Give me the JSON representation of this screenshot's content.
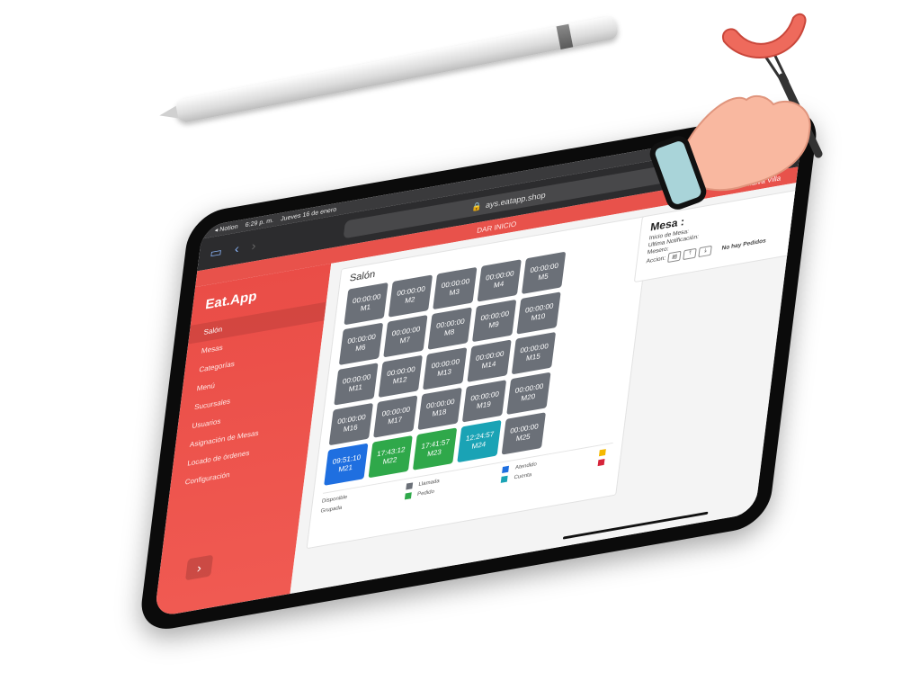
{
  "status_bar": {
    "carrier": "◂ Notion",
    "time": "6:29 p. m.",
    "date": "Jueves 16 de enero"
  },
  "browser": {
    "url": "ays.eatapp.shop",
    "dots": "•••"
  },
  "header": {
    "center": "DAR INICIO",
    "user": "Malva Villa"
  },
  "sidebar": {
    "logo": "Eat.App",
    "items": [
      {
        "label": "Salón",
        "active": true
      },
      {
        "label": "Mesas"
      },
      {
        "label": "Categorías"
      },
      {
        "label": "Menú"
      },
      {
        "label": "Sucursales"
      },
      {
        "label": "Usuarios"
      },
      {
        "label": "Asignación de Mesas"
      },
      {
        "label": "Locado de órdenes"
      },
      {
        "label": "Configuración"
      }
    ],
    "expand_icon": "chevron-right"
  },
  "salon": {
    "title": "Salón",
    "tables": [
      {
        "time": "00:00:00",
        "name": "M1",
        "status": "disponible"
      },
      {
        "time": "00:00:00",
        "name": "M2",
        "status": "disponible"
      },
      {
        "time": "00:00:00",
        "name": "M3",
        "status": "disponible"
      },
      {
        "time": "00:00:00",
        "name": "M4",
        "status": "disponible"
      },
      {
        "time": "00:00:00",
        "name": "M5",
        "status": "disponible"
      },
      {
        "time": "00:00:00",
        "name": "M6",
        "status": "disponible"
      },
      {
        "time": "00:00:00",
        "name": "M7",
        "status": "disponible"
      },
      {
        "time": "00:00:00",
        "name": "M8",
        "status": "disponible"
      },
      {
        "time": "00:00:00",
        "name": "M9",
        "status": "disponible"
      },
      {
        "time": "00:00:00",
        "name": "M10",
        "status": "disponible"
      },
      {
        "time": "00:00:00",
        "name": "M11",
        "status": "disponible"
      },
      {
        "time": "00:00:00",
        "name": "M12",
        "status": "disponible"
      },
      {
        "time": "00:00:00",
        "name": "M13",
        "status": "disponible"
      },
      {
        "time": "00:00:00",
        "name": "M14",
        "status": "disponible"
      },
      {
        "time": "00:00:00",
        "name": "M15",
        "status": "disponible"
      },
      {
        "time": "00:00:00",
        "name": "M16",
        "status": "disponible"
      },
      {
        "time": "00:00:00",
        "name": "M17",
        "status": "disponible"
      },
      {
        "time": "00:00:00",
        "name": "M18",
        "status": "disponible"
      },
      {
        "time": "00:00:00",
        "name": "M19",
        "status": "disponible"
      },
      {
        "time": "00:00:00",
        "name": "M20",
        "status": "disponible"
      },
      {
        "time": "09:51:10",
        "name": "M21",
        "status": "llamada"
      },
      {
        "time": "17:43:12",
        "name": "M22",
        "status": "pedido"
      },
      {
        "time": "17:41:57",
        "name": "M23",
        "status": "pedido"
      },
      {
        "time": "12:24:57",
        "name": "M24",
        "status": "cuenta"
      },
      {
        "time": "00:00:00",
        "name": "M25",
        "status": "disponible"
      }
    ],
    "legend": [
      {
        "label": "Disponible",
        "color": "#6b7078"
      },
      {
        "label": "Llamada",
        "color": "#1f6fe0"
      },
      {
        "label": "Atendido",
        "color": "#f5b800"
      },
      {
        "label": "Grupada",
        "color": "#2fa84a"
      },
      {
        "label": "Pedido",
        "color": "#1aa3b5"
      },
      {
        "label": "Cuenta",
        "color": "#d6243a"
      }
    ]
  },
  "status_colors": {
    "disponible": "#6b7078",
    "llamada": "#1f6fe0",
    "pedido": "#2fa84a",
    "cuenta": "#1aa3b5"
  },
  "mesa_panel": {
    "title": "Mesa :",
    "inicio": "Inicio de Mesa:",
    "ultima": "Ultima Notificación:",
    "mesero": "Mesero:",
    "accion": "Accion:",
    "no_pedidos": "No hay Pedidos",
    "action_icons": [
      "document-icon",
      "upload-icon",
      "download-icon"
    ]
  },
  "brand": {
    "accent": "#ea4d47"
  }
}
